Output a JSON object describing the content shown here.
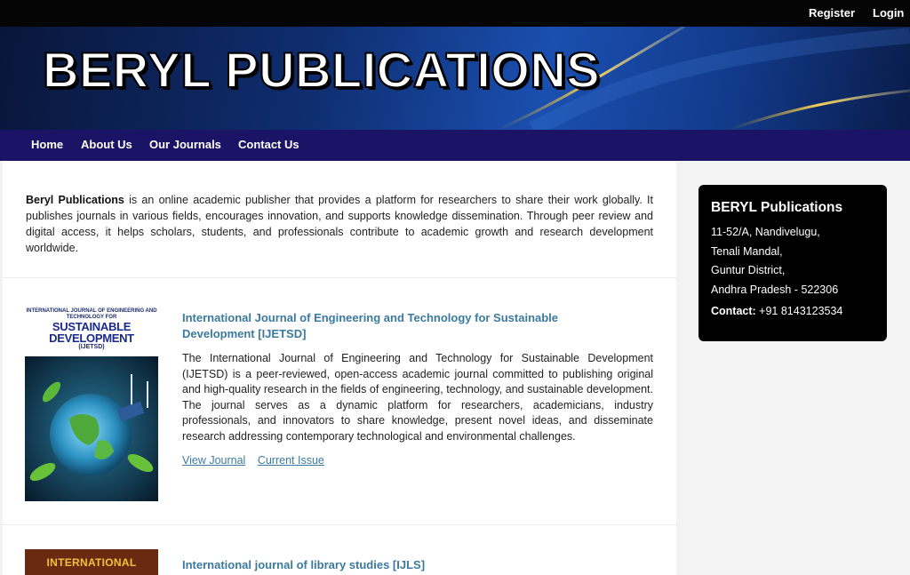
{
  "topbar": {
    "register": "Register",
    "login": "Login"
  },
  "banner": {
    "title": "BERYL PUBLICATIONS"
  },
  "nav": {
    "items": [
      "Home",
      "About Us",
      "Our Journals",
      "Contact Us"
    ]
  },
  "intro": {
    "brand": "Beryl Publications",
    "text": " is an online academic publisher that provides a platform for researchers to share their work globally. It publishes journals in various fields, encourages innovation, and supports knowledge dissemination. Through peer review and digital access, it helps scholars, students, and professionals contribute to academic growth and research development worldwide."
  },
  "journals": [
    {
      "cover_small": "INTERNATIONAL JOURNAL OF ENGINEERING AND TECHNOLOGY FOR",
      "cover_big": "SUSTAINABLE DEVELOPMENT",
      "cover_abbr": "(IJETSD)",
      "title": "International Journal of Engineering and Technology for Sustainable Development [IJETSD]",
      "description": "The International Journal of Engineering and Technology for Sustainable Development (IJETSD) is a peer-reviewed, open-access academic journal committed to publishing original and high-quality research in the fields of engineering, technology, and sustainable development. The journal serves as a dynamic platform for researchers, academicians, industry professionals, and innovators to share knowledge, present novel ideas, and disseminate research addressing contemporary technological and environmental challenges.",
      "view_link": "View Journal",
      "issue_link": "Current Issue"
    },
    {
      "cover_text": "INTERNATIONAL",
      "title": "International journal of library studies [IJLS]"
    }
  ],
  "sidebar": {
    "title": "BERYL Publications",
    "address": [
      "11-52/A, Nandivelugu,",
      "Tenali Mandal,",
      "Guntur District,",
      "Andhra Pradesh - 522306"
    ],
    "contact_label": "Contact:",
    "contact_value": " +91 8143123534"
  }
}
